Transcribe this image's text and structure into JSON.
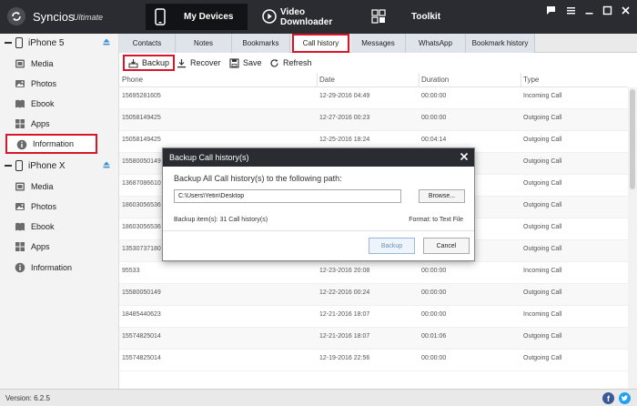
{
  "app": {
    "name": "Syncios",
    "edition": "Ultimate"
  },
  "nav": {
    "devices": "My Devices",
    "video": "Video Downloader",
    "toolkit": "Toolkit"
  },
  "devices": [
    {
      "name": "iPhone 5",
      "items": [
        "Media",
        "Photos",
        "Ebook",
        "Apps",
        "Information"
      ]
    },
    {
      "name": "iPhone X",
      "items": [
        "Media",
        "Photos",
        "Ebook",
        "Apps",
        "Information"
      ]
    }
  ],
  "tabs": [
    "Contacts",
    "Notes",
    "Bookmarks",
    "Call history",
    "Messages",
    "WhatsApp",
    "Bookmark history"
  ],
  "toolbar": {
    "backup": "Backup",
    "recover": "Recover",
    "save": "Save",
    "refresh": "Refresh"
  },
  "table": {
    "headers": [
      "Phone",
      "Date",
      "Duration",
      "Type"
    ],
    "rows": [
      [
        "15695281605",
        "12-29-2016 04:49",
        "00:00:00",
        "Incoming Call"
      ],
      [
        "15058149425",
        "12-27-2016 00:23",
        "00:00:00",
        "Outgoing Call"
      ],
      [
        "15058149425",
        "12-25-2016 18:24",
        "00:04:14",
        "Outgoing Call"
      ],
      [
        "15580050149",
        "",
        "",
        "Outgoing Call"
      ],
      [
        "13687086610",
        "",
        "",
        "Outgoing Call"
      ],
      [
        "18603056536",
        "",
        "",
        "Outgoing Call"
      ],
      [
        "18603056536",
        "",
        "",
        "Outgoing Call"
      ],
      [
        "13530737180",
        "",
        "",
        "Outgoing Call"
      ],
      [
        "95533",
        "12-23-2016 20:08",
        "00:00:00",
        "Incoming Call"
      ],
      [
        "15580050149",
        "12-22-2016 00:24",
        "00:00:00",
        "Outgoing Call"
      ],
      [
        "18485440623",
        "12-21-2016 18:07",
        "00:00:00",
        "Incoming Call"
      ],
      [
        "15574825014",
        "12-21-2016 18:07",
        "00:01:06",
        "Outgoing Call"
      ],
      [
        "15574825014",
        "12-19-2016 22:56",
        "00:00:00",
        "Outgoing Call"
      ]
    ]
  },
  "dialog": {
    "title": "Backup Call history(s)",
    "message": "Backup All Call history(s) to the following path:",
    "path": "C:\\Users\\Yetin\\Desktop",
    "browse": "Browse...",
    "items": "Backup item(s): 31 Call history(s)",
    "format": "Format: to Text File",
    "backup": "Backup",
    "cancel": "Cancel"
  },
  "status": {
    "version": "Version: 6.2.5"
  },
  "colors": {
    "accent": "#d8162a",
    "titlebar": "#2a2c31",
    "facebook": "#3b5998",
    "twitter": "#1da1f2"
  }
}
